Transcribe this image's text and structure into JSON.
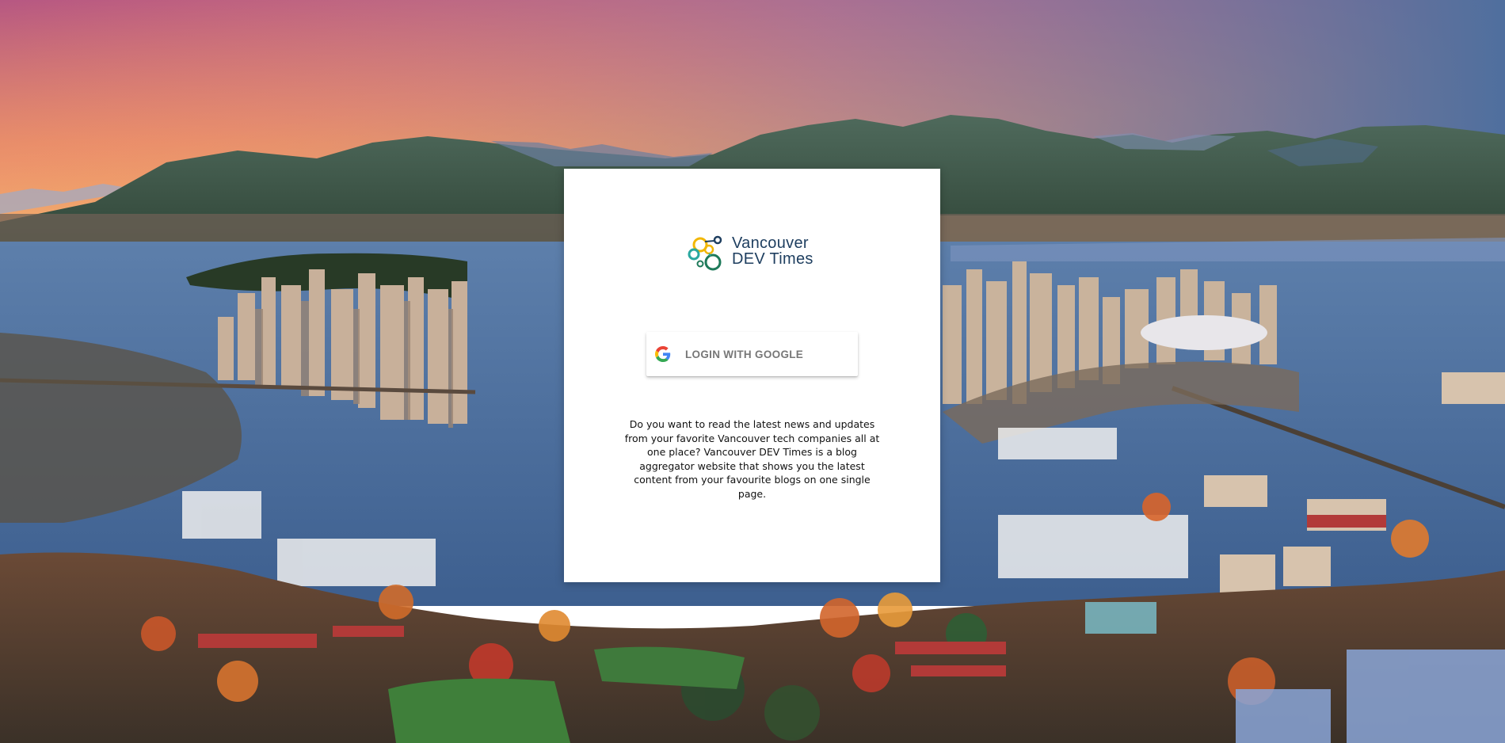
{
  "logo": {
    "line1": "Vancouver",
    "line2": "DEV Times"
  },
  "login": {
    "label": "LOGIN WITH GOOGLE",
    "icon": "google-g-icon"
  },
  "description": "Do you want to read the latest news and updates from your favorite Vancouver tech companies all at one place? Vancouver DEV Times is a blog aggregator website that shows you the latest content from your favourite blogs on one single page.",
  "colors": {
    "brand_text": "#1f3f60",
    "logo_green": "#1e7a5a",
    "logo_yellow": "#f2b705",
    "logo_teal": "#2aa8a0",
    "card_background": "#ffffff",
    "button_text": "#777777"
  }
}
